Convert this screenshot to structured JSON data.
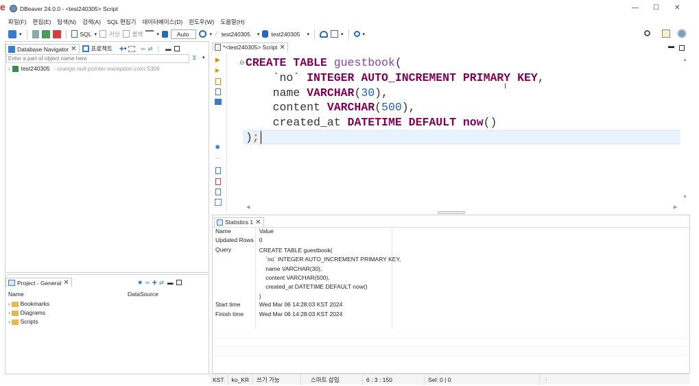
{
  "window": {
    "title": "DBeaver 24.0.0 - <test240305> Script",
    "minimize": "—",
    "maximize": "☐",
    "close": "✕"
  },
  "menu": [
    "파일(F)",
    "편집(E)",
    "탐색(N)",
    "검색(A)",
    "SQL 편집기",
    "데이터베이스(D)",
    "윈도우(W)",
    "도움말(H)"
  ],
  "toolbar": {
    "sql": "SQL",
    "commit": "커밋",
    "rollback": "롤백",
    "mode": "Auto",
    "datasource": "test240305",
    "schema": "test240305"
  },
  "navigator": {
    "title": "Database Navigator",
    "tab2": "프로젝트",
    "filter_placeholder": "Enter a part of object name here",
    "conn_name": "test240305",
    "conn_host": "- orange.null-pointer-exception.com:5306"
  },
  "project": {
    "title": "Project - General",
    "col_name": "Name",
    "col_ds": "DataSource",
    "items": [
      "Bookmarks",
      "Diagrams",
      "Scripts"
    ]
  },
  "editor": {
    "tab": "*<test240305> Script"
  },
  "code": {
    "l1_kw": "CREATE TABLE",
    "l1_id": "guestbook",
    "l1_p": "(",
    "l2_id": "`no`",
    "l2_kw1": "INTEGER",
    "l2_kw2": "AUTO_INCREMENT",
    "l2_kw3": "PRIMARY KEY",
    "l2_p": ",",
    "l3_id": "name",
    "l3_kw": "VARCHAR",
    "l3_p1": "(",
    "l3_num": "30",
    "l3_p2": "),",
    "l4_id": "content",
    "l4_kw": "VARCHAR",
    "l4_p1": "(",
    "l4_num": "500",
    "l4_p2": "),",
    "l5_id": "created_at",
    "l5_kw1": "DATETIME",
    "l5_kw2": "DEFAULT",
    "l5_kw3": "now",
    "l5_p": "()",
    "l6_p": ")",
    "l6_s": ";"
  },
  "stats": {
    "tab": "Statistics 1",
    "col_name": "Name",
    "col_value": "Value",
    "rows": [
      {
        "name": "Updated Rows",
        "value": "0"
      },
      {
        "name": "Query",
        "value": "CREATE TABLE guestbook(\n    `no` INTEGER AUTO_INCREMENT PRIMARY KEY,\n    name VARCHAR(30),\n    content VARCHAR(500),\n    created_at DATETIME DEFAULT now()\n)"
      },
      {
        "name": "Start time",
        "value": "Wed Mar 06 14:28:03 KST 2024"
      },
      {
        "name": "Finish time",
        "value": "Wed Mar 06 14:28:03 KST 2024"
      }
    ]
  },
  "status": {
    "tz": "KST",
    "locale": "ko_KR",
    "writable": "쓰기 가능",
    "insert": "스마트 삽입",
    "pos": "6 : 3 : 150",
    "sel": "Sel: 0 | 0"
  },
  "colors": {
    "keyword": "#7f0055",
    "identifier": "#8a3fb3",
    "number": "#2060d0",
    "current_line": "#e8f2fe"
  }
}
